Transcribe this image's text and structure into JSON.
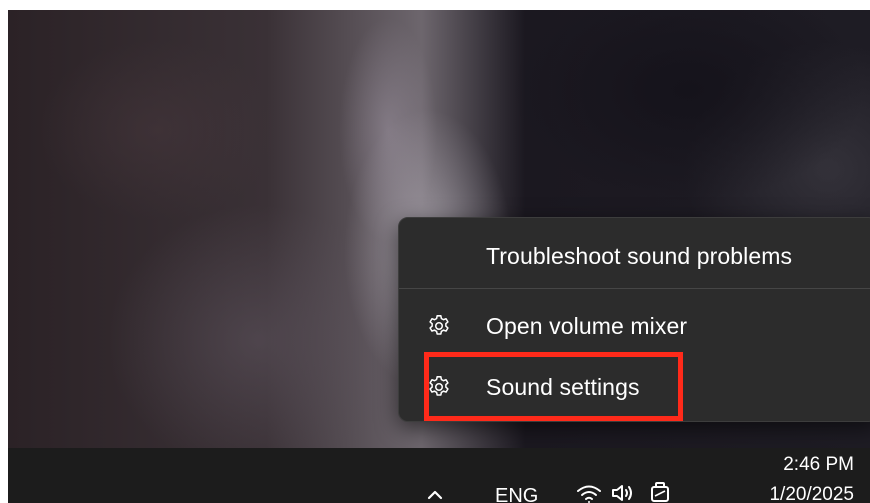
{
  "context_menu": {
    "items": [
      {
        "label": "Troubleshoot sound problems",
        "icon": null
      },
      {
        "label": "Open volume mixer",
        "icon": "gear-icon"
      },
      {
        "label": "Sound settings",
        "icon": "gear-icon",
        "highlighted": true
      }
    ]
  },
  "taskbar": {
    "language": "ENG",
    "time": "2:46 PM",
    "date": "1/20/2025",
    "icons": [
      "chevron-up-icon",
      "wifi-icon",
      "speaker-icon",
      "battery-icon"
    ]
  },
  "colors": {
    "menu_bg": "#2c2c2c",
    "taskbar_bg": "#1c1c1c",
    "highlight": "#ff2a1a",
    "text": "#ffffff"
  }
}
